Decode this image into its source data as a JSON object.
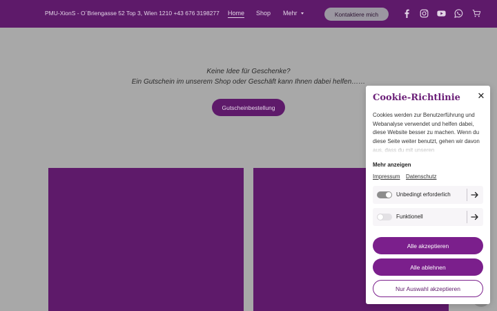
{
  "header": {
    "brand": "PMU-XionS - O´Briengasse 52 Top 3, Wien 1210 +43 676 3198277",
    "nav": {
      "home": "Home",
      "shop": "Shop",
      "mehr": "Mehr"
    },
    "contact_label": "Kontaktiere mich",
    "icons": [
      "facebook-icon",
      "instagram-icon",
      "youtube-icon",
      "whatsapp-icon",
      "cart-icon"
    ]
  },
  "main": {
    "intro_line1": "Keine Idee für Geschenke?",
    "intro_line2": "Ein Gutschein im unserem Shop oder Geschäft kann Ihnen dabei helfen……",
    "gift_button": "Gutscheinbestellung"
  },
  "cookie": {
    "title": "Cookie-Richtlinie",
    "text": "Cookies werden zur Benutzerführung und Webanalyse verwendet und helfen dabei, diese Website besser zu machen. Wenn du diese Seite weiter benutzt, gehen wir davon aus, dass du mit unseren",
    "more": "Mehr anzeigen",
    "link_impressum": "Impressum",
    "link_datenschutz": "Datenschutz",
    "row_required": "Unbedingt erforderlich",
    "row_functional": "Funktionell",
    "required_enabled": true,
    "functional_enabled": false,
    "accept_all": "Alle akzeptieren",
    "reject_all": "Alle ablehnen",
    "accept_selection": "Nur Auswahl akzeptieren"
  },
  "colors": {
    "brand_purple": "#5e1a6a",
    "button_purple": "#7b1f8c",
    "overlay_gray": "#a8a8a8"
  }
}
